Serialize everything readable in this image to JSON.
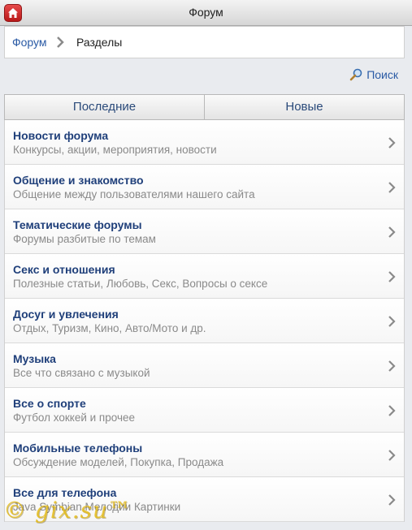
{
  "app": {
    "title": "Форум"
  },
  "breadcrumb": {
    "root": "Форум",
    "current": "Разделы"
  },
  "search": {
    "label": "Поиск"
  },
  "tabs": [
    {
      "label": "Последние"
    },
    {
      "label": "Новые"
    }
  ],
  "sections": [
    {
      "title": "Новости форума",
      "subtitle": "Конкурсы, акции, мероприятия, новости"
    },
    {
      "title": "Общение и знакомство",
      "subtitle": "Общение между пользователями нашего сайта"
    },
    {
      "title": "Тематические форумы",
      "subtitle": "Форумы разбитые по темам"
    },
    {
      "title": "Секс и отношения",
      "subtitle": "Полезные статьи, Любовь, Секс, Вопросы о сексе"
    },
    {
      "title": "Досуг и увлечения",
      "subtitle": "Отдых, Туризм, Кино, Авто/Мото и др."
    },
    {
      "title": "Музыка",
      "subtitle": "Все что связано с музыкой"
    },
    {
      "title": "Все о спорте",
      "subtitle": "Футбол хоккей и прочее"
    },
    {
      "title": "Мобильные телефоны",
      "subtitle": "Обсуждение моделей, Покупка, Продажа"
    },
    {
      "title": "Все для телефона",
      "subtitle": "Java Symbian Мелодии Картинки"
    }
  ],
  "watermark": "© gix.su™",
  "colors": {
    "link": "#2a5aa5",
    "title": "#1f3f7a",
    "home": "#d32f2f"
  }
}
